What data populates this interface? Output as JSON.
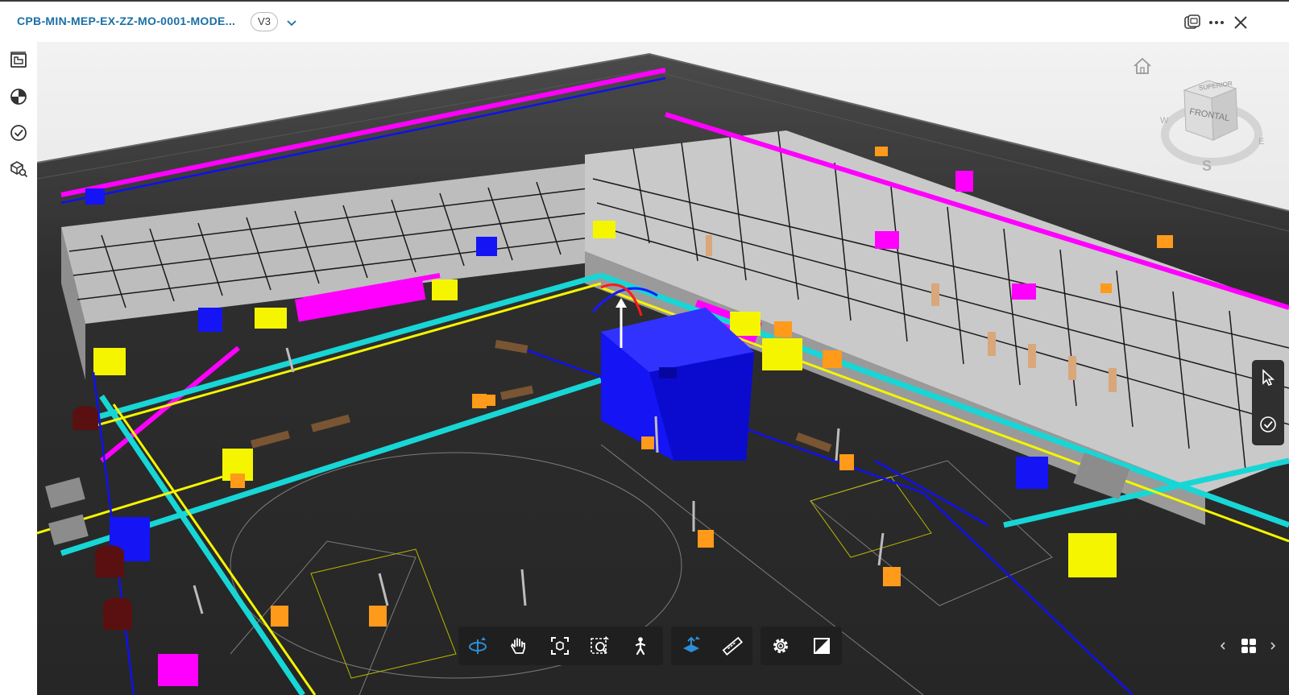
{
  "window": {
    "file_title": "CPB-MIN-MEP-EX-ZZ-MO-0001-MODE...",
    "version": "V3"
  },
  "icons": {
    "version_dropdown": "chevron-down-icon",
    "title_actions": [
      "compare-icon",
      "more-icon",
      "close-icon"
    ],
    "sidebar": [
      "sheets-icon",
      "model-browser-icon",
      "issues-icon",
      "search-model-icon"
    ],
    "right_panel": [
      "select-cursor-icon",
      "checkmark-icon"
    ],
    "toolbar_navigation": [
      "orbit-icon",
      "pan-icon",
      "fit-to-view-icon",
      "zoom-window-icon",
      "first-person-icon"
    ],
    "toolbar_tools": [
      "section-icon",
      "measure-icon"
    ],
    "toolbar_settings": [
      "settings-icon",
      "fullscreen-icon"
    ],
    "page_nav": [
      "chevron-left-icon",
      "grid-view-icon",
      "chevron-right-icon"
    ]
  },
  "viewcube": {
    "top_face": "SUPERIOR",
    "front_face": "FRONTAL",
    "west": "W",
    "east": "E",
    "south": "S"
  },
  "colors": {
    "accent": "#1a6fa5",
    "toolbar_bg": "#1f1f1f",
    "viewport_bg": "#2d2d2d",
    "duct_magenta": "#ff00ff",
    "duct_cyan": "#18d6d6",
    "duct_yellow": "#f5f500",
    "pipe_blue": "#1010f0",
    "equipment_orange": "#ff9a1a"
  }
}
